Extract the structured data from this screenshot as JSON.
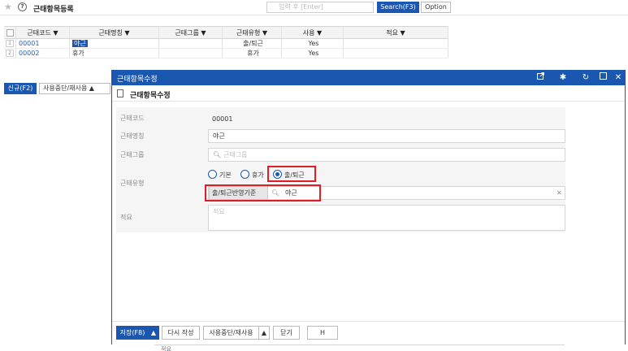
{
  "page": {
    "title": "근태항목등록"
  },
  "search": {
    "placeholder": "입력 후 [Enter]",
    "search_label": "Search(F3)",
    "option_label": "Option"
  },
  "grid": {
    "headers": [
      "근태코드 ▼",
      "근태명칭 ▼",
      "근태그룹 ▼",
      "근태유형 ▼",
      "사용 ▼",
      "적요 ▼"
    ],
    "rows": [
      {
        "num": "1",
        "code": "00001",
        "name": "야근",
        "group": "",
        "type": "출/퇴근",
        "use": "Yes",
        "memo": ""
      },
      {
        "num": "2",
        "code": "00002",
        "name": "휴가",
        "group": "",
        "type": "휴가",
        "use": "Yes",
        "memo": ""
      }
    ]
  },
  "background_toolbar": {
    "new_label": "신규(F2)",
    "stop_label": "사용중단/재사용 ▲"
  },
  "modal": {
    "title": "근태항목수정",
    "subtitle": "근태항목수정",
    "icons": [
      "external-link-icon",
      "pin-icon",
      "refresh-icon",
      "maximize-icon",
      "close-icon"
    ],
    "fields": {
      "code": {
        "label": "근태코드",
        "value": "00001"
      },
      "name": {
        "label": "근태명칭",
        "value": "야근"
      },
      "group": {
        "label": "근태그룹",
        "placeholder": "근태그룹"
      },
      "type": {
        "label": "근태유형",
        "options": [
          "기본",
          "휴가",
          "출/퇴근"
        ],
        "selected": "출/퇴근",
        "ref_label": "출/퇴근반영기준",
        "ref_value": "야근"
      },
      "memo": {
        "label": "적요",
        "placeholder": "적요"
      }
    },
    "footer": {
      "save_label": "저장(F8)",
      "rewrite_label": "다시 작성",
      "stop_label": "사용중단/재사용",
      "close_label": "닫기",
      "h_label": "H"
    }
  },
  "background_bottom": {
    "memo_label": "적요"
  },
  "colors": {
    "accent": "#1a57b0",
    "highlight": "#e21c24"
  }
}
